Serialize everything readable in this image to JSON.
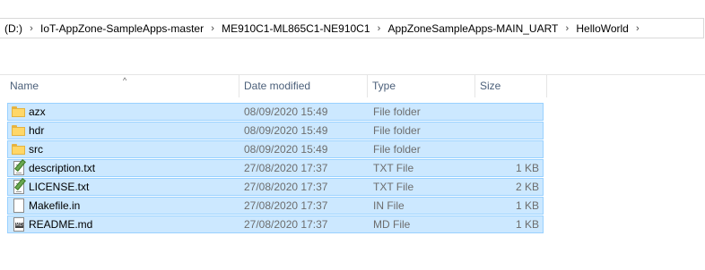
{
  "breadcrumb": [
    {
      "label": "(D:)"
    },
    {
      "label": "IoT-AppZone-SampleApps-master"
    },
    {
      "label": "ME910C1-ML865C1-NE910C1"
    },
    {
      "label": "AppZoneSampleApps-MAIN_UART"
    },
    {
      "label": "HelloWorld"
    }
  ],
  "chevron": "›",
  "columns": {
    "name": "Name",
    "date": "Date modified",
    "type": "Type",
    "size": "Size",
    "sort_indicator": "^"
  },
  "files": [
    {
      "name": "azx",
      "date": "08/09/2020 15:49",
      "type": "File folder",
      "size": "",
      "icon": "folder-icon"
    },
    {
      "name": "hdr",
      "date": "08/09/2020 15:49",
      "type": "File folder",
      "size": "",
      "icon": "folder-icon"
    },
    {
      "name": "src",
      "date": "08/09/2020 15:49",
      "type": "File folder",
      "size": "",
      "icon": "folder-icon"
    },
    {
      "name": "description.txt",
      "date": "27/08/2020 17:37",
      "type": "TXT File",
      "size": "1 KB",
      "icon": "text-file-icon"
    },
    {
      "name": "LICENSE.txt",
      "date": "27/08/2020 17:37",
      "type": "TXT File",
      "size": "2 KB",
      "icon": "text-file-icon"
    },
    {
      "name": "Makefile.in",
      "date": "27/08/2020 17:37",
      "type": "IN File",
      "size": "1 KB",
      "icon": "generic-file-icon"
    },
    {
      "name": "README.md",
      "date": "27/08/2020 17:37",
      "type": "MD File",
      "size": "1 KB",
      "icon": "markdown-file-icon"
    }
  ],
  "colors": {
    "selection_fill": "#cce8ff",
    "selection_border": "#99d1ff",
    "header_text": "#4c607a",
    "secondary_text": "#6d6d6d"
  }
}
